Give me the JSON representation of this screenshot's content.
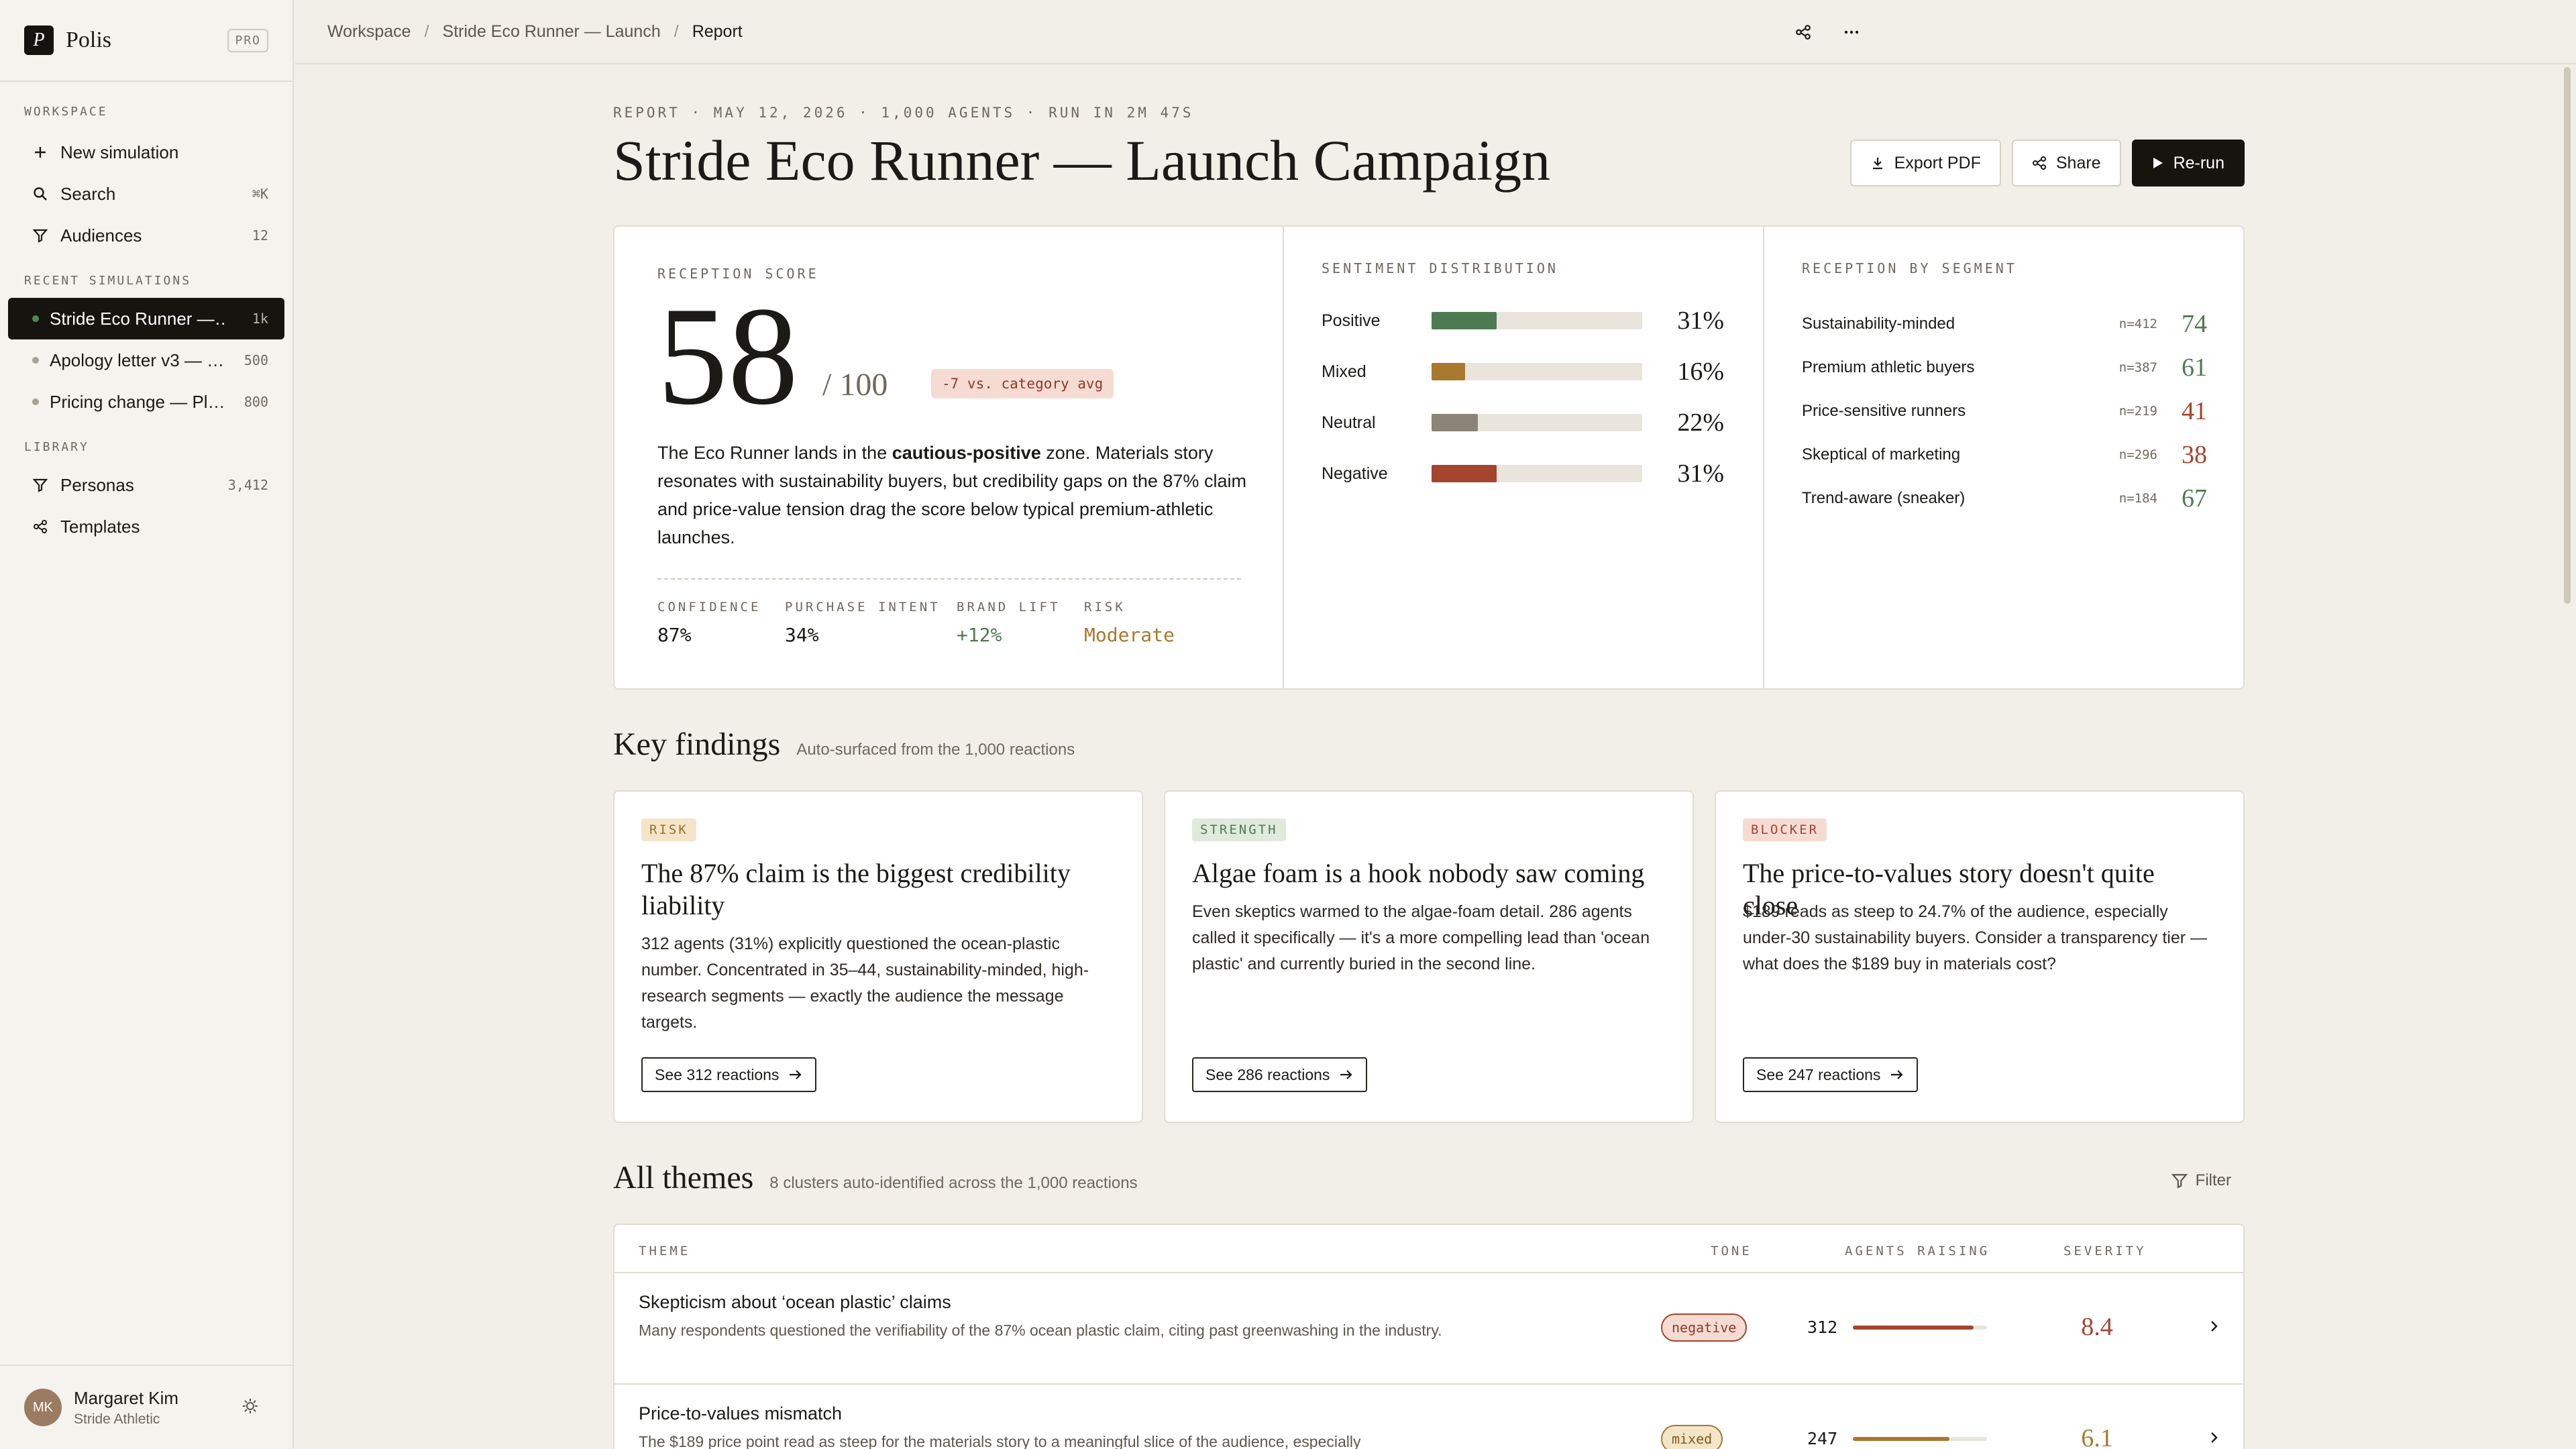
{
  "app": {
    "name": "Polis",
    "plan": "PRO",
    "logo_glyph": "P"
  },
  "sidebar": {
    "workspace_title": "WORKSPACE",
    "workspace_items": [
      {
        "label": "New simulation",
        "icon": "plus-icon"
      },
      {
        "label": "Search",
        "icon": "search-icon",
        "count": "⌘K"
      },
      {
        "label": "Audiences",
        "icon": "filter-icon",
        "count": "12"
      }
    ],
    "recent_title": "RECENT SIMULATIONS",
    "recent_items": [
      {
        "label": "Stride Eco Runner —…",
        "count": "1k",
        "active": true
      },
      {
        "label": "Apology letter v3 — …",
        "count": "500"
      },
      {
        "label": "Pricing change — Pl…",
        "count": "800"
      }
    ],
    "library_title": "LIBRARY",
    "library_items": [
      {
        "label": "Personas",
        "icon": "filter-icon",
        "count": "3,412"
      },
      {
        "label": "Templates",
        "icon": "share-icon"
      }
    ],
    "user": {
      "initials": "MK",
      "name": "Margaret Kim",
      "org": "Stride Athletic"
    }
  },
  "breadcrumb": [
    "Workspace",
    "Stride Eco Runner — Launch",
    "Report"
  ],
  "report": {
    "meta": "REPORT · MAY 12, 2026 · 1,000 AGENTS · RUN IN 2M 47S",
    "title": "Stride Eco Runner — Launch Campaign",
    "actions": {
      "export": "Export PDF",
      "share": "Share",
      "rerun": "Re-run"
    }
  },
  "score_card": {
    "label": "RECEPTION SCORE",
    "score": "58",
    "out_of": "/ 100",
    "delta": "-7 vs. category avg",
    "summary_pre": "The Eco Runner lands in the ",
    "summary_bold": "cautious-positive",
    "summary_post": " zone. Materials story resonates with sustainability buyers, but credibility gaps on the 87% claim and price-value tension drag the score below typical premium-athletic launches.",
    "stats": [
      {
        "label": "CONFIDENCE",
        "value": "87%"
      },
      {
        "label": "PURCHASE INTENT",
        "value": "34%"
      },
      {
        "label": "BRAND LIFT",
        "value": "+12%"
      },
      {
        "label": "RISK",
        "value": "Moderate"
      }
    ]
  },
  "sentiment": {
    "label": "SENTIMENT DISTRIBUTION",
    "rows": [
      {
        "label": "Positive",
        "pct": "31%",
        "value": 31,
        "color": "#4e7a52"
      },
      {
        "label": "Mixed",
        "pct": "16%",
        "value": 16,
        "color": "#a8792f"
      },
      {
        "label": "Neutral",
        "pct": "22%",
        "value": 22,
        "color": "#8b8477"
      },
      {
        "label": "Negative",
        "pct": "31%",
        "value": 31,
        "color": "#a3452f"
      }
    ]
  },
  "segments": {
    "label": "RECEPTION BY SEGMENT",
    "rows": [
      {
        "name": "Sustainability-minded",
        "n": "n=412",
        "score": "74",
        "color": "#4e7a52"
      },
      {
        "name": "Premium athletic buyers",
        "n": "n=387",
        "score": "61",
        "color": "#4e7a52"
      },
      {
        "name": "Price-sensitive runners",
        "n": "n=219",
        "score": "41",
        "color": "#a3452f"
      },
      {
        "name": "Skeptical of marketing",
        "n": "n=296",
        "score": "38",
        "color": "#a3452f"
      },
      {
        "name": "Trend-aware (sneaker)",
        "n": "n=184",
        "score": "67",
        "color": "#4e7a52"
      }
    ]
  },
  "findings": {
    "title": "Key findings",
    "subtitle": "Auto-surfaced from the 1,000 reactions",
    "cards": [
      {
        "badge": "RISK",
        "title": "The 87% claim is the biggest credibility liability",
        "body": "312 agents (31%) explicitly questioned the ocean-plastic number. Concentrated in 35–44, sustainability-minded, high-research segments — exactly the audience the message targets.",
        "cta": "See 312 reactions"
      },
      {
        "badge": "STRENGTH",
        "title": "Algae foam is a hook nobody saw coming",
        "body": "Even skeptics warmed to the algae-foam detail. 286 agents called it specifically — it's a more compelling lead than 'ocean plastic' and currently buried in the second line.",
        "cta": "See 286 reactions"
      },
      {
        "badge": "BLOCKER",
        "title": "The price-to-values story doesn't quite close",
        "body": "$189 reads as steep to 24.7% of the audience, especially under-30 sustainability buyers. Consider a transparency tier — what does the $189 buy in materials cost?",
        "cta": "See 247 reactions"
      }
    ]
  },
  "themes": {
    "title": "All themes",
    "subtitle": "8 clusters auto-identified across the 1,000 reactions",
    "filter": "Filter",
    "columns": [
      "THEME",
      "TONE",
      "AGENTS RAISING",
      "SEVERITY"
    ],
    "rows": [
      {
        "name": "Skepticism about ‘ocean plastic’ claims",
        "desc": "Many respondents questioned the verifiability of the 87% ocean plastic claim, citing past greenwashing in the industry.",
        "tone": "negative",
        "agents": "312",
        "bar": 0.9,
        "severity": "8.4"
      },
      {
        "name": "Price-to-values mismatch",
        "desc": "The $189 price point read as steep for the materials story to a meaningful slice of the audience, especially",
        "tone": "mixed",
        "agents": "247",
        "bar": 0.72,
        "severity": "6.1"
      }
    ]
  }
}
